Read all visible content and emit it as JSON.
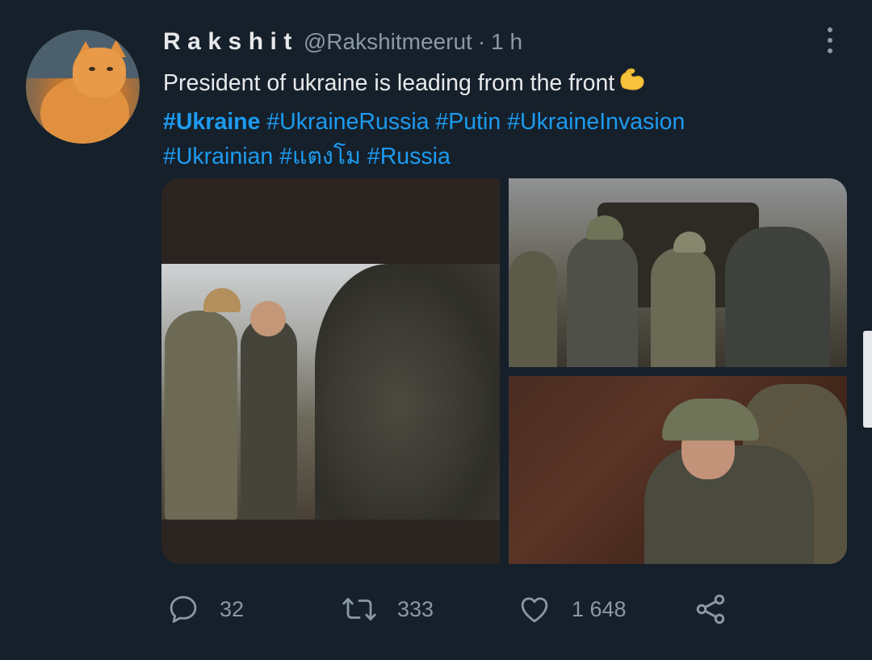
{
  "tweet": {
    "display_name": "Rakshit",
    "handle": "@Rakshitmeerut",
    "separator": "·",
    "time": "1 h",
    "text": "President of ukraine is leading from the front",
    "hashtags": [
      "#Ukraine",
      "#UkraineRussia",
      "#Putin",
      "#UkraineInvasion",
      "#Ukrainian",
      "#แตงโม",
      "#Russia"
    ]
  },
  "icons": {
    "more": "more-vertical-icon",
    "reply": "reply-icon",
    "retweet": "retweet-icon",
    "like": "heart-icon",
    "share": "share-icon",
    "emoji": "flexed-biceps-emoji"
  },
  "actions": {
    "reply_count": "32",
    "retweet_count": "333",
    "like_count": "1 648"
  },
  "colors": {
    "background": "#15202b",
    "text": "#e7e9ea",
    "secondary": "#8b98a5",
    "link": "#1d9bf0"
  }
}
